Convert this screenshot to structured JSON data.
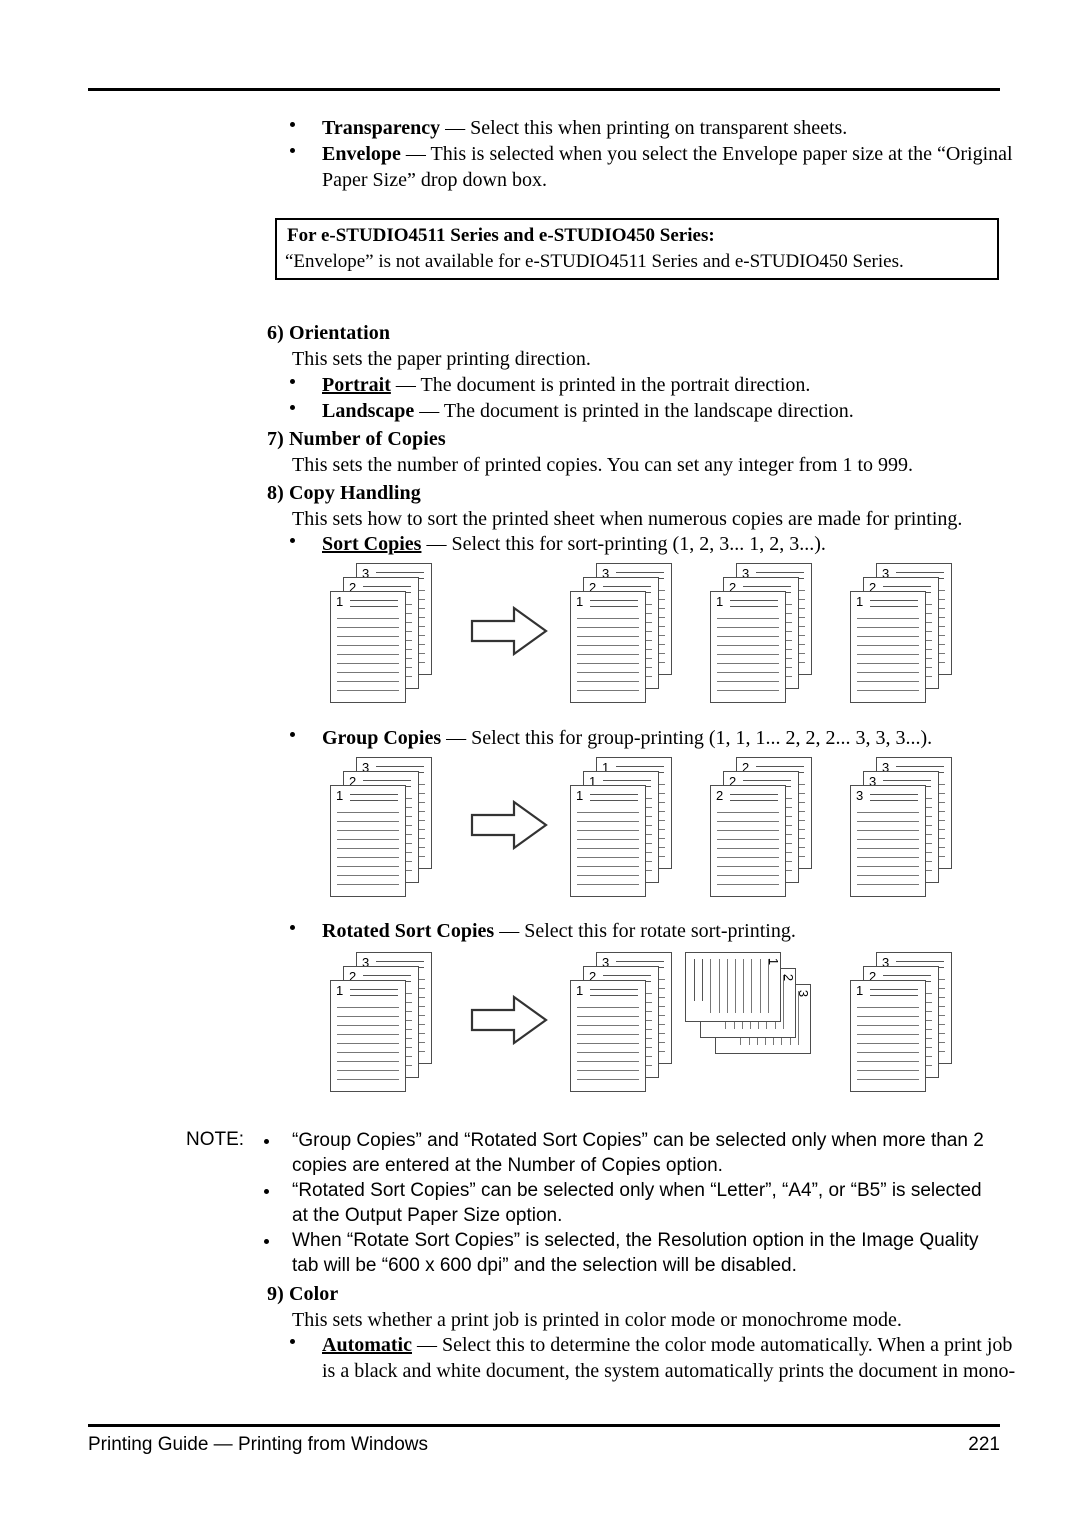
{
  "document": {
    "footer": {
      "left": "Printing Guide — Printing from Windows",
      "page_number": "221"
    }
  },
  "top_bullets": [
    {
      "term": "Transparency",
      "dash": " — ",
      "rest": "Select this when printing on transparent sheets."
    },
    {
      "term": "Envelope",
      "dash": " — ",
      "rest": "This is selected when you select the Envelope paper size at the “Original",
      "rest_line2": "Paper Size” drop down box."
    }
  ],
  "infobox": {
    "title": "For e-STUDIO4511 Series and e-STUDIO450 Series:",
    "body": "“Envelope” is not available for e-STUDIO4511 Series and e-STUDIO450 Series."
  },
  "sections": {
    "orientation": {
      "heading": "6) Orientation",
      "intro": "This sets the paper printing direction.",
      "bullets": [
        {
          "term": "Portrait",
          "underlined": true,
          "dash": " — ",
          "rest": "The document is printed in the portrait direction."
        },
        {
          "term": "Landscape",
          "underlined": false,
          "dash": " — ",
          "rest": "The document is printed in the landscape direction."
        }
      ]
    },
    "number_of_copies": {
      "heading": "7) Number of Copies",
      "intro": "This sets the number of printed copies.  You can set any integer from 1 to 999."
    },
    "copy_handling": {
      "heading": "8) Copy Handling",
      "intro": "This sets how to sort the printed sheet when numerous copies are made for printing.",
      "bullets": [
        {
          "term": "Sort Copies",
          "underlined": true,
          "dash": " — ",
          "rest": "Select this for sort-printing (1, 2, 3... 1, 2, 3...)."
        },
        {
          "term": "Group Copies",
          "underlined": false,
          "dash": " — ",
          "rest": "Select this for group-printing (1, 1, 1... 2, 2, 2... 3, 3, 3...)."
        },
        {
          "term": "Rotated Sort Copies",
          "underlined": false,
          "dash": " — ",
          "rest": "Select this for rotate sort-printing."
        }
      ]
    },
    "color": {
      "heading": "9) Color",
      "intro": "This sets whether a print job is printed in color mode or monochrome mode.",
      "bullets": [
        {
          "term": "Automatic",
          "underlined": true,
          "dash": " — ",
          "rest": "Select this to determine the color mode automatically.  When a print job",
          "rest_line2": "is a black and white document, the system automatically prints the document in mono-"
        }
      ]
    }
  },
  "note": {
    "label": "NOTE:",
    "items": [
      {
        "line1": "“Group Copies” and “Rotated Sort Copies” can be selected only when more than 2",
        "line2": "copies are entered at the Number of Copies option."
      },
      {
        "line1": "“Rotated Sort Copies” can be selected only when “Letter”, “A4”, or “B5” is selected",
        "line2": "at the Output Paper Size option."
      },
      {
        "line1": "When “Rotate Sort Copies” is selected, the Resolution option in the Image Quality",
        "line2": "tab will be “600 x 600 dpi” and the selection will be disabled."
      }
    ]
  },
  "diagrams": {
    "sort_copies": {
      "name": "sort-copies-diagram",
      "input_stack": [
        "3",
        "2",
        "1"
      ],
      "output_stacks": [
        [
          "3",
          "2",
          "1"
        ],
        [
          "3",
          "2",
          "1"
        ],
        [
          "3",
          "2",
          "1"
        ]
      ]
    },
    "group_copies": {
      "name": "group-copies-diagram",
      "input_stack": [
        "3",
        "2",
        "1"
      ],
      "output_stacks": [
        [
          "1",
          "1",
          "1"
        ],
        [
          "2",
          "2",
          "2"
        ],
        [
          "3",
          "3",
          "3"
        ]
      ]
    },
    "rotated_sort_copies": {
      "name": "rotated-sort-copies-diagram",
      "input_stack": [
        "3",
        "2",
        "1"
      ],
      "output_stacks": [
        [
          "3",
          "2",
          "1"
        ],
        [
          "3",
          "2",
          "1"
        ]
      ],
      "rotated_stack_index": 0
    }
  }
}
